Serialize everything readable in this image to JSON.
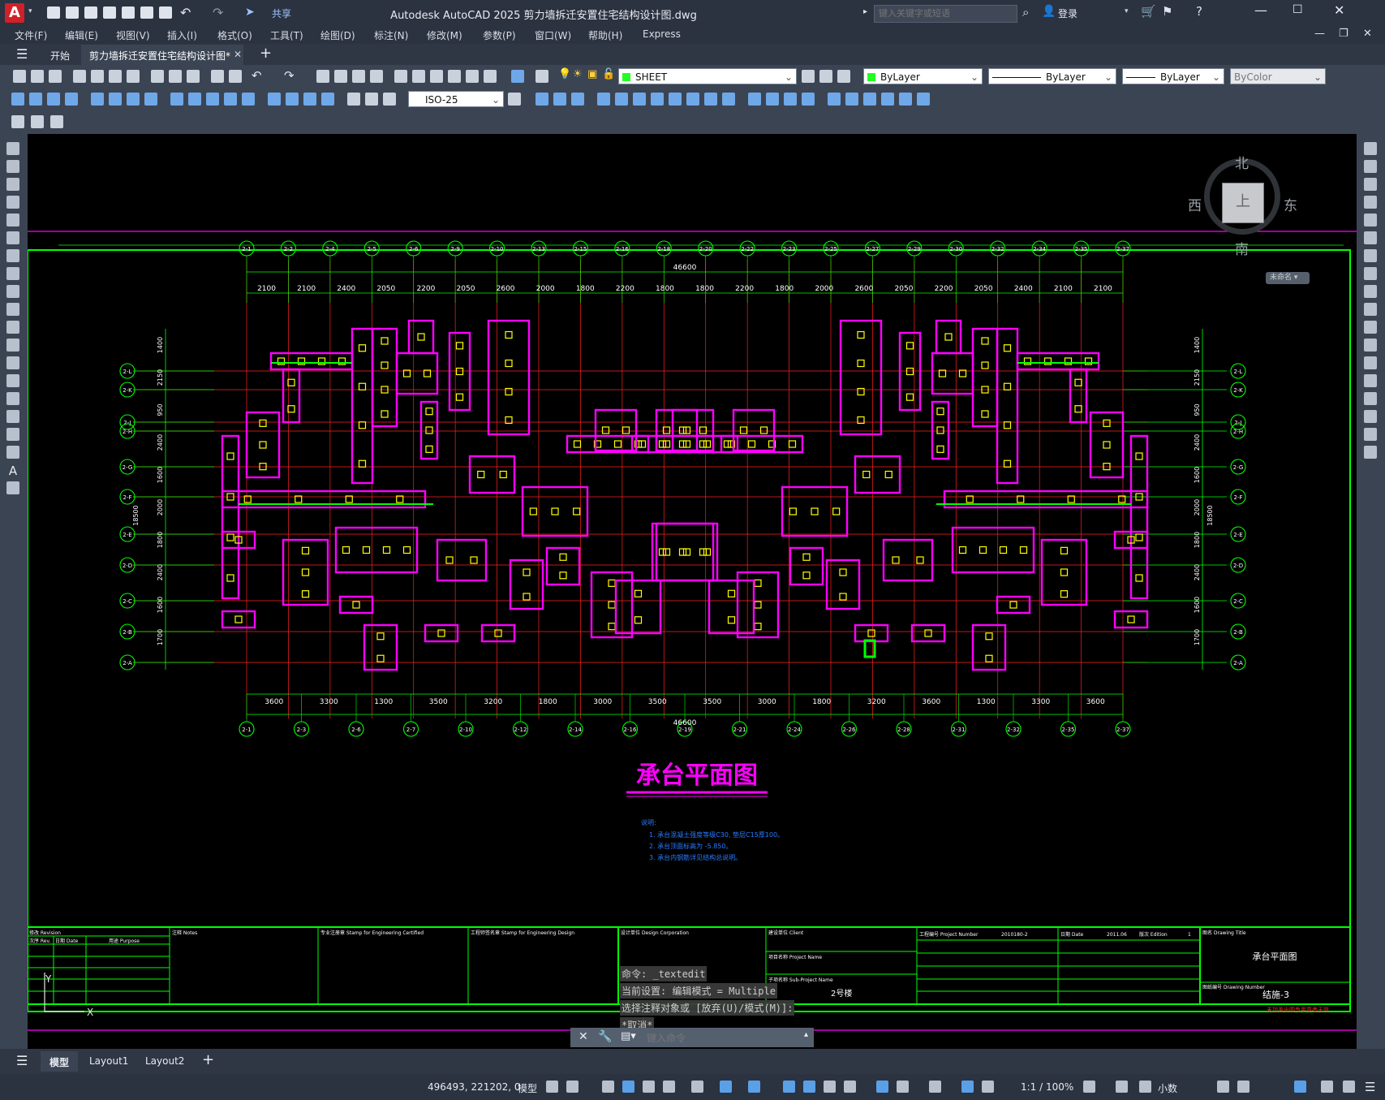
{
  "titlebar": {
    "share": "共享",
    "title": "Autodesk AutoCAD 2025    剪力墙拆迁安置住宅结构设计图.dwg",
    "search_placeholder": "键入关键字或短语",
    "signin": "登录"
  },
  "menu": [
    "文件(F)",
    "编辑(E)",
    "视图(V)",
    "插入(I)",
    "格式(O)",
    "工具(T)",
    "绘图(D)",
    "标注(N)",
    "修改(M)",
    "参数(P)",
    "窗口(W)",
    "帮助(H)",
    "Express"
  ],
  "tabs": {
    "start": "开始",
    "file": "剪力墙拆迁安置住宅结构设计图*"
  },
  "toolbar": {
    "layer": "SHEET",
    "color": "ByLayer",
    "linetype": "ByLayer",
    "lineweight": "ByLayer",
    "plotstyle": "ByColor",
    "dimstyle": "ISO-25"
  },
  "viewcube": {
    "north": "北",
    "south": "南",
    "east": "东",
    "west": "西",
    "face": "上",
    "ucs": "未命名"
  },
  "drawing": {
    "title": "承台平面图",
    "total_dim": "46600",
    "top_dims": [
      "2100",
      "2100",
      "2400",
      "2050",
      "2200",
      "2050",
      "2600",
      "2000",
      "1800",
      "2200",
      "1800",
      "1800",
      "2200",
      "1800",
      "2000",
      "2600",
      "2050",
      "2200",
      "2050",
      "2400",
      "2100",
      "2100"
    ],
    "bottom_dims": [
      "3600",
      "3300",
      "1300",
      "3500",
      "3200",
      "1800",
      "3000",
      "3500",
      "3500",
      "3000",
      "1800",
      "3200",
      "3600",
      "1300",
      "3300",
      "3600"
    ],
    "axes_top": [
      "2-1",
      "2-2",
      "2-4",
      "2-5",
      "2-6",
      "2-9",
      "2-10",
      "2-13",
      "2-15",
      "2-16",
      "2-18",
      "2-20",
      "2-22",
      "2-23",
      "2-25",
      "2-27",
      "2-29",
      "2-30",
      "2-32",
      "2-34",
      "2-35",
      "2-37"
    ],
    "axes_bottom": [
      "2-1",
      "2-3",
      "2-6",
      "2-7",
      "2-10",
      "2-12",
      "2-14",
      "2-16",
      "2-19",
      "2-21",
      "2-24",
      "2-26",
      "2-28",
      "2-31",
      "2-32",
      "2-35",
      "2-37"
    ],
    "axes_left": [
      "2-L",
      "2-K",
      "2-J",
      "2-H",
      "2-G",
      "2-F",
      "2-E",
      "2-D",
      "2-C",
      "2-B",
      "2-A"
    ],
    "left_dims": [
      "1400",
      "2150",
      "950",
      "2400",
      "1600",
      "2000",
      "1800",
      "2400",
      "1600",
      "1700"
    ],
    "left_total": "18500",
    "notes": [
      "说明:",
      "1. 承台混凝土强度等级C30, 垫层C15厚100。",
      "2. 承台顶面标高为 -5.850。",
      "3. 承台内钢筋详见结构总说明。"
    ],
    "title_block": {
      "revision": "修改 Revision",
      "rev_cols": [
        "次序 Rev.",
        "日期 Date",
        "用途 Purpose"
      ],
      "notes_label": "注释 Notes",
      "stamp1": "专业注册章 Stamp for Engineering Certified",
      "stamp2": "工程师签名章 Stamp for Engineering Design",
      "design_corp": "设计单位 Design Corporation",
      "client": "建设单位 Client",
      "project": "项目名称 Project Name",
      "subproject": "子项名称 Sub-Project Name",
      "building": "2号楼",
      "project_no_label": "工程编号 Project Number",
      "project_no": "2010180-2",
      "date_label": "日期 Date",
      "date": "2011.06",
      "edition_label": "版次 Edition",
      "edition": "1",
      "drawing_name_label": "图名 Drawing Title",
      "drawing_name": "承台平面图",
      "drawing_no_label": "图纸编号 Drawing Number",
      "drawing_no": "结施-3",
      "footer": "未加盖出图专用章者无效"
    }
  },
  "command": {
    "history": [
      "命令: _textedit",
      "当前设置: 编辑模式 = Multiple",
      "选择注释对象或 [放弃(U)/模式(M)]:",
      "*取消*"
    ],
    "placeholder": "键入命令"
  },
  "layouts": [
    "模型",
    "Layout1",
    "Layout2"
  ],
  "status": {
    "coords": "496493, 221202, 0",
    "model": "模型",
    "scale": "1:1 / 100%",
    "units": "小数"
  }
}
